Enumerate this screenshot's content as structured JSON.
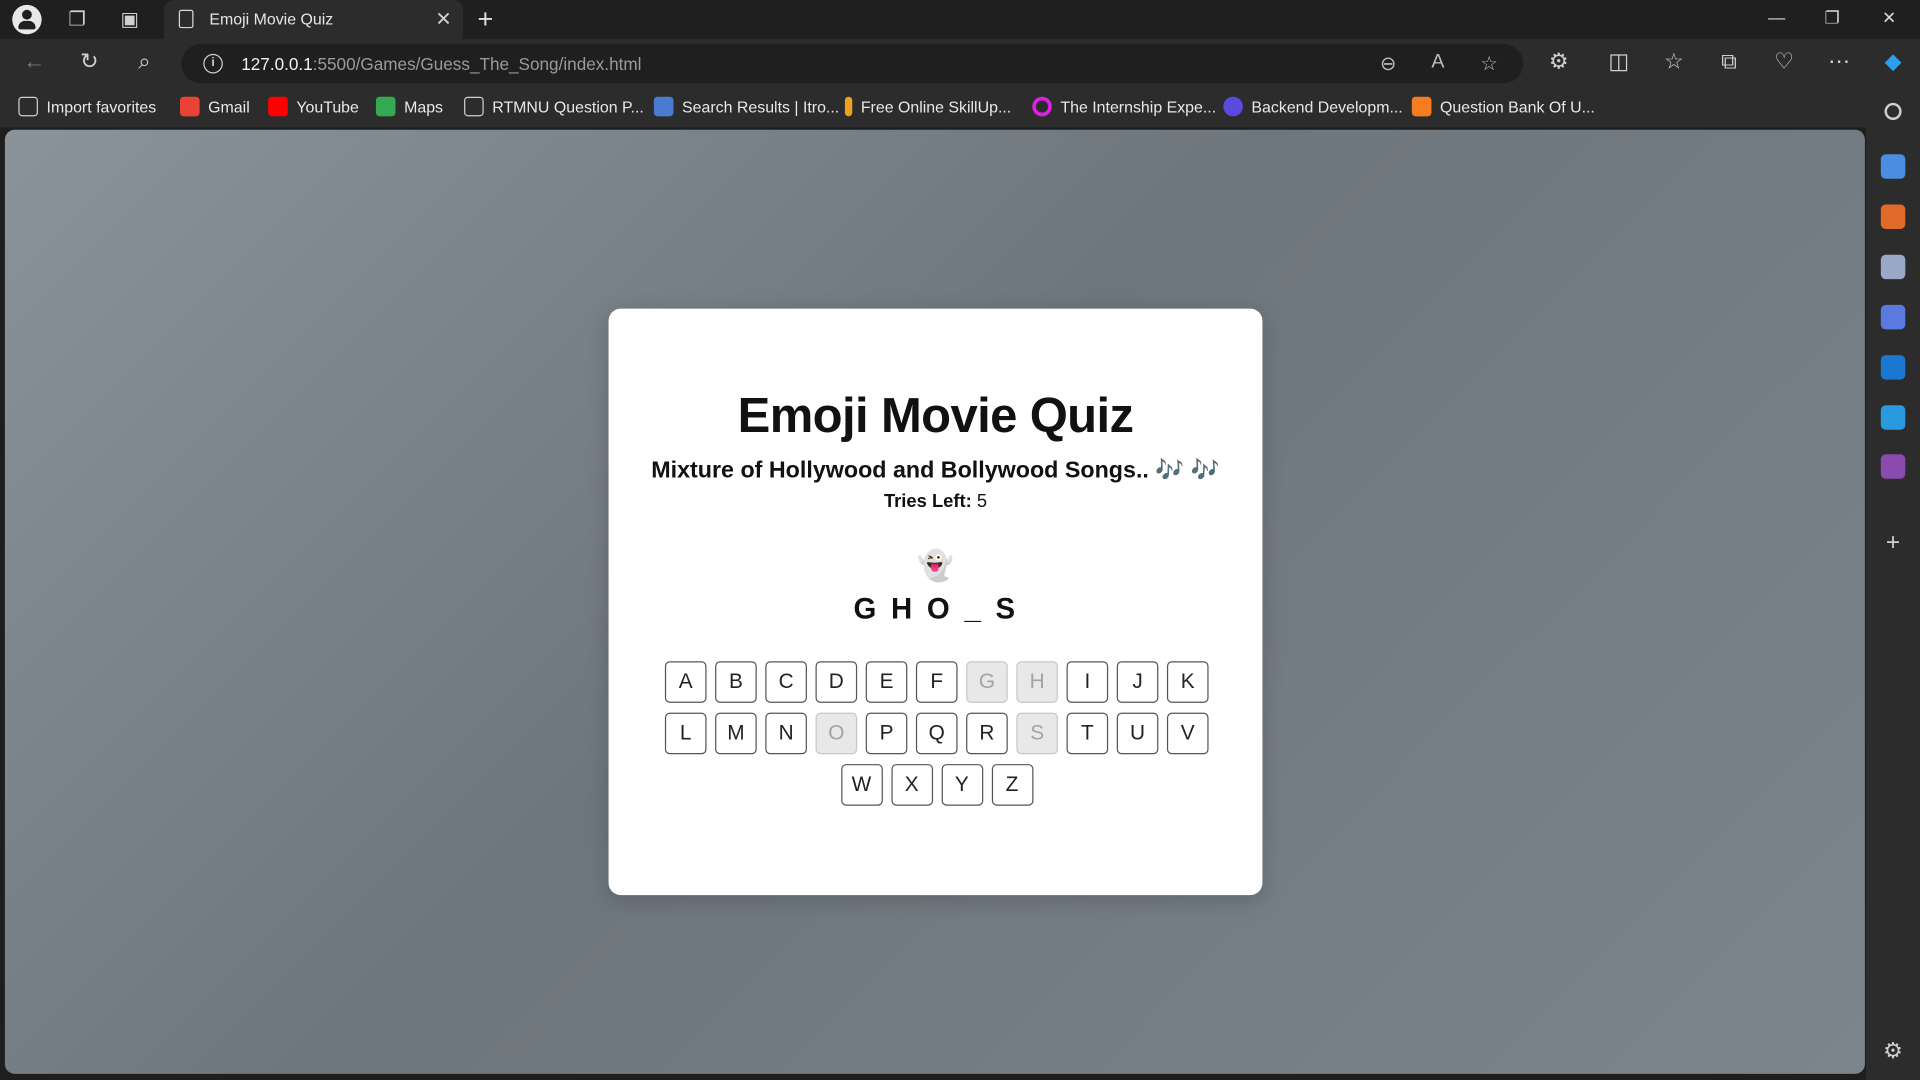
{
  "browser": {
    "tab_title": "Emoji Movie Quiz",
    "url_host": "127.0.0.1",
    "url_rest": ":5500/Games/Guess_The_Song/index.html"
  },
  "bookmarks": [
    {
      "label": "Import favorites",
      "color": "#cfcfcf"
    },
    {
      "label": "Gmail",
      "color": "#ea4335"
    },
    {
      "label": "YouTube",
      "color": "#ff0000"
    },
    {
      "label": "Maps",
      "color": "#34a853"
    },
    {
      "label": "RTMNU Question P...",
      "color": "#cfcfcf"
    },
    {
      "label": "Search Results | Itro...",
      "color": "#4a7bd0"
    },
    {
      "label": "Free Online SkillUp...",
      "color": "#f0a020"
    },
    {
      "label": "The Internship Expe...",
      "color": "#e020e0"
    },
    {
      "label": "Backend Developm...",
      "color": "#5a4ae0"
    },
    {
      "label": "Question Bank Of U...",
      "color": "#f57c20"
    }
  ],
  "game": {
    "title": "Emoji Movie Quiz",
    "subtitle": "Mixture of Hollywood and Bollywood Songs.. 🎶 🎶",
    "tries_label": "Tries Left:",
    "tries_value": "5",
    "emoji_hint": "👻",
    "word_display": "GHO_S",
    "keyboard_rows": [
      [
        "A",
        "B",
        "C",
        "D",
        "E",
        "F",
        "G",
        "H",
        "I",
        "J",
        "K"
      ],
      [
        "L",
        "M",
        "N",
        "O",
        "P",
        "Q",
        "R",
        "S",
        "T",
        "U",
        "V"
      ],
      [
        "W",
        "X",
        "Y",
        "Z"
      ]
    ],
    "used_letters": [
      "G",
      "H",
      "O",
      "S"
    ]
  }
}
